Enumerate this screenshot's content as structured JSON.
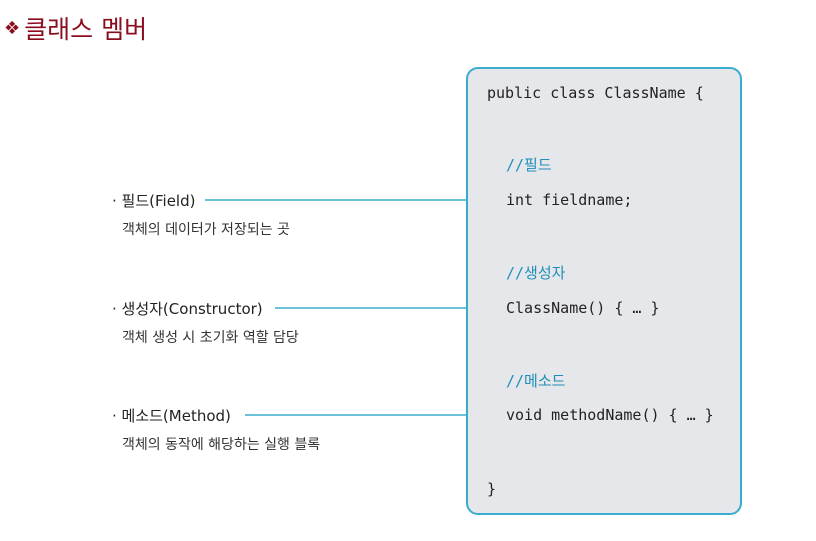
{
  "title": {
    "bullet": "❖",
    "text": "클래스 멤버"
  },
  "code": {
    "header": "public class ClassName {",
    "field_comment": "//필드",
    "field_line": "int fieldname;",
    "constructor_comment": "//생성자",
    "constructor_line": "ClassName() { … }",
    "method_comment": "//메소드",
    "method_line": "void methodName() { … }",
    "closing": "}"
  },
  "members": [
    {
      "name": "· 필드(Field)",
      "description": "객체의 데이터가 저장되는 곳"
    },
    {
      "name": "· 생성자(Constructor)",
      "description": "객체 생성 시 초기화 역할 담당"
    },
    {
      "name": "· 메소드(Method)",
      "description": "객체의 동작에 해당하는 실행 블록"
    }
  ],
  "colors": {
    "title": "#8b0e1f",
    "accent": "#3aaccd",
    "box_fill": "#e6e7ea",
    "comment": "#1f8fb8"
  }
}
